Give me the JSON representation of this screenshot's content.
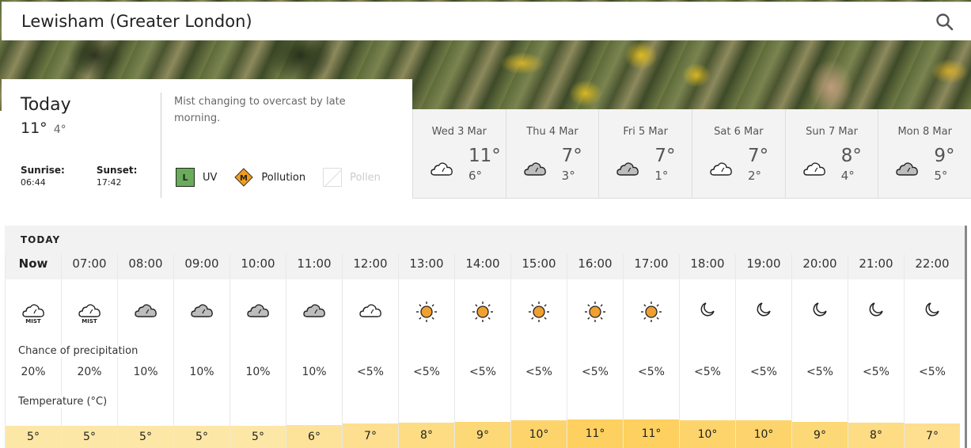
{
  "header": {
    "location": "Lewisham (Greater London)",
    "search_icon": "search-icon"
  },
  "today": {
    "label": "Today",
    "high": "11°",
    "low": "4°",
    "sunrise_label": "Sunrise:",
    "sunrise": "06:44",
    "sunset_label": "Sunset:",
    "sunset": "17:42",
    "summary": "Mist changing to overcast by late morning.",
    "uv": {
      "badge": "L",
      "label": "UV",
      "color": "#6aab5c"
    },
    "pollution": {
      "badge": "M",
      "label": "Pollution",
      "color": "#f39c1b"
    },
    "pollen": {
      "label": "Pollen",
      "available": false
    }
  },
  "days": [
    {
      "name": "Wed 3 Mar",
      "high": "11°",
      "low": "6°",
      "icon": "white-cloud"
    },
    {
      "name": "Thu 4 Mar",
      "high": "7°",
      "low": "3°",
      "icon": "grey-cloud"
    },
    {
      "name": "Fri 5 Mar",
      "high": "7°",
      "low": "1°",
      "icon": "grey-cloud"
    },
    {
      "name": "Sat 6 Mar",
      "high": "7°",
      "low": "2°",
      "icon": "white-cloud"
    },
    {
      "name": "Sun 7 Mar",
      "high": "8°",
      "low": "4°",
      "icon": "white-cloud"
    },
    {
      "name": "Mon 8 Mar",
      "high": "9°",
      "low": "5°",
      "icon": "grey-cloud"
    }
  ],
  "hourly": {
    "caption": "TODAY",
    "precip_label": "Chance of precipitation",
    "temp_label": "Temperature (°C)",
    "hours": [
      {
        "time": "Now",
        "icon": "mist",
        "icon_label": "MIST",
        "precip": "20%",
        "temp": "5°",
        "temp_value": 5
      },
      {
        "time": "07:00",
        "icon": "mist",
        "icon_label": "MIST",
        "precip": "20%",
        "temp": "5°",
        "temp_value": 5
      },
      {
        "time": "08:00",
        "icon": "grey-cloud",
        "icon_label": "",
        "precip": "10%",
        "temp": "5°",
        "temp_value": 5
      },
      {
        "time": "09:00",
        "icon": "grey-cloud",
        "icon_label": "",
        "precip": "10%",
        "temp": "5°",
        "temp_value": 5
      },
      {
        "time": "10:00",
        "icon": "grey-cloud",
        "icon_label": "",
        "precip": "10%",
        "temp": "5°",
        "temp_value": 5
      },
      {
        "time": "11:00",
        "icon": "grey-cloud",
        "icon_label": "",
        "precip": "10%",
        "temp": "6°",
        "temp_value": 6
      },
      {
        "time": "12:00",
        "icon": "white-cloud",
        "icon_label": "",
        "precip": "<5%",
        "temp": "7°",
        "temp_value": 7
      },
      {
        "time": "13:00",
        "icon": "sun",
        "icon_label": "",
        "precip": "<5%",
        "temp": "8°",
        "temp_value": 8
      },
      {
        "time": "14:00",
        "icon": "sun",
        "icon_label": "",
        "precip": "<5%",
        "temp": "9°",
        "temp_value": 9
      },
      {
        "time": "15:00",
        "icon": "sun",
        "icon_label": "",
        "precip": "<5%",
        "temp": "10°",
        "temp_value": 10
      },
      {
        "time": "16:00",
        "icon": "sun",
        "icon_label": "",
        "precip": "<5%",
        "temp": "11°",
        "temp_value": 11
      },
      {
        "time": "17:00",
        "icon": "sun",
        "icon_label": "",
        "precip": "<5%",
        "temp": "11°",
        "temp_value": 11
      },
      {
        "time": "18:00",
        "icon": "moon",
        "icon_label": "",
        "precip": "<5%",
        "temp": "10°",
        "temp_value": 10
      },
      {
        "time": "19:00",
        "icon": "moon",
        "icon_label": "",
        "precip": "<5%",
        "temp": "10°",
        "temp_value": 10
      },
      {
        "time": "20:00",
        "icon": "moon",
        "icon_label": "",
        "precip": "<5%",
        "temp": "9°",
        "temp_value": 9
      },
      {
        "time": "21:00",
        "icon": "moon",
        "icon_label": "",
        "precip": "<5%",
        "temp": "8°",
        "temp_value": 8
      },
      {
        "time": "22:00",
        "icon": "moon",
        "icon_label": "",
        "precip": "<5%",
        "temp": "7°",
        "temp_value": 7
      }
    ]
  },
  "colors": {
    "temp_band_low": "#fde7a6",
    "temp_band_high": "#fdd060",
    "sun": "#f0a030",
    "cloud_grey": "#bdbdbd"
  }
}
